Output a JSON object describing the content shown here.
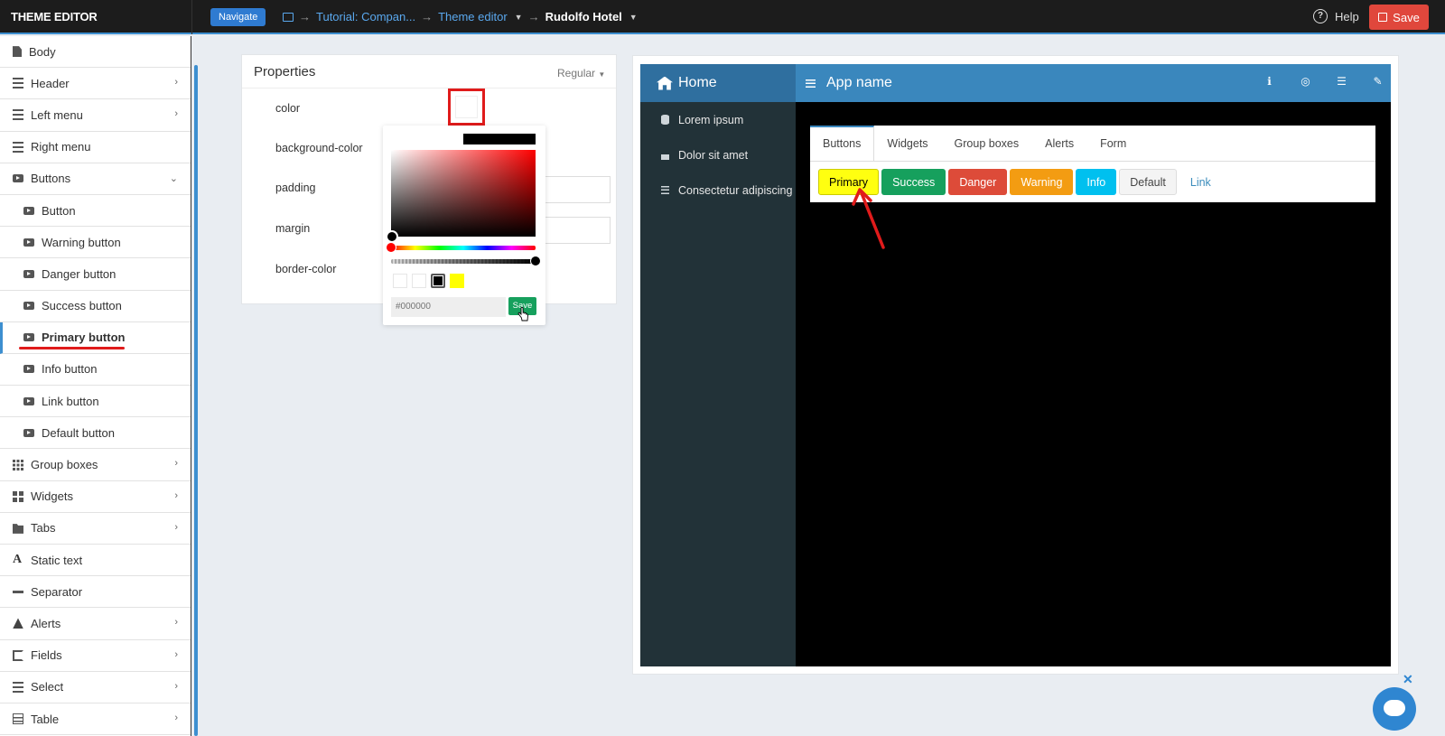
{
  "topbar": {
    "brand": "THEME EDITOR",
    "navigate_label": "Navigate",
    "breadcrumb": [
      "Tutorial: Compan...",
      "Theme editor",
      "Rudolfo Hotel"
    ],
    "help_label": "Help",
    "save_label": "Save"
  },
  "sidebar": {
    "items": [
      {
        "label": "Body",
        "icon": "document-icon"
      },
      {
        "label": "Header",
        "icon": "bars-icon"
      },
      {
        "label": "Left menu",
        "icon": "bars-icon"
      },
      {
        "label": "Right menu",
        "icon": "bars-icon"
      },
      {
        "label": "Buttons",
        "icon": "video-icon"
      },
      {
        "label": "Button",
        "icon": "video-icon"
      },
      {
        "label": "Warning button",
        "icon": "video-icon"
      },
      {
        "label": "Danger button",
        "icon": "video-icon"
      },
      {
        "label": "Success button",
        "icon": "video-icon"
      },
      {
        "label": "Primary button",
        "icon": "video-icon"
      },
      {
        "label": "Info button",
        "icon": "video-icon"
      },
      {
        "label": "Link button",
        "icon": "video-icon"
      },
      {
        "label": "Default button",
        "icon": "video-icon"
      },
      {
        "label": "Group boxes",
        "icon": "grid-icon"
      },
      {
        "label": "Widgets",
        "icon": "widgets-icon"
      },
      {
        "label": "Tabs",
        "icon": "folder-icon"
      },
      {
        "label": "Static text",
        "icon": "text-icon"
      },
      {
        "label": "Separator",
        "icon": "minus-icon"
      },
      {
        "label": "Alerts",
        "icon": "warning-icon"
      },
      {
        "label": "Fields",
        "icon": "fields-icon"
      },
      {
        "label": "Select",
        "icon": "list-icon"
      },
      {
        "label": "Table",
        "icon": "table-icon"
      }
    ]
  },
  "properties": {
    "title": "Properties",
    "mode": "Regular",
    "rows": [
      "color",
      "background-color",
      "padding",
      "margin",
      "border-color"
    ]
  },
  "picker": {
    "hex_placeholder": "#000000",
    "save_label": "Save",
    "presets": [
      "#ffffff",
      "#ffffff",
      "#000000",
      "#ffff00"
    ]
  },
  "preview": {
    "home_label": "Home",
    "app_name": "App name",
    "side_items": [
      "Lorem ipsum",
      "Dolor sit amet",
      "Consectetur adipiscing"
    ],
    "tabs": [
      "Buttons",
      "Widgets",
      "Group boxes",
      "Alerts",
      "Form"
    ],
    "buttons": [
      "Primary",
      "Success",
      "Danger",
      "Warning",
      "Info",
      "Default",
      "Link"
    ]
  },
  "colors": {
    "accent": "#3d8fd0",
    "save_red": "#e0473c",
    "primary_yellow": "#ffff10",
    "success": "#16a05d",
    "danger": "#dd4b39",
    "warning": "#f39c12",
    "info": "#00c0ef"
  }
}
